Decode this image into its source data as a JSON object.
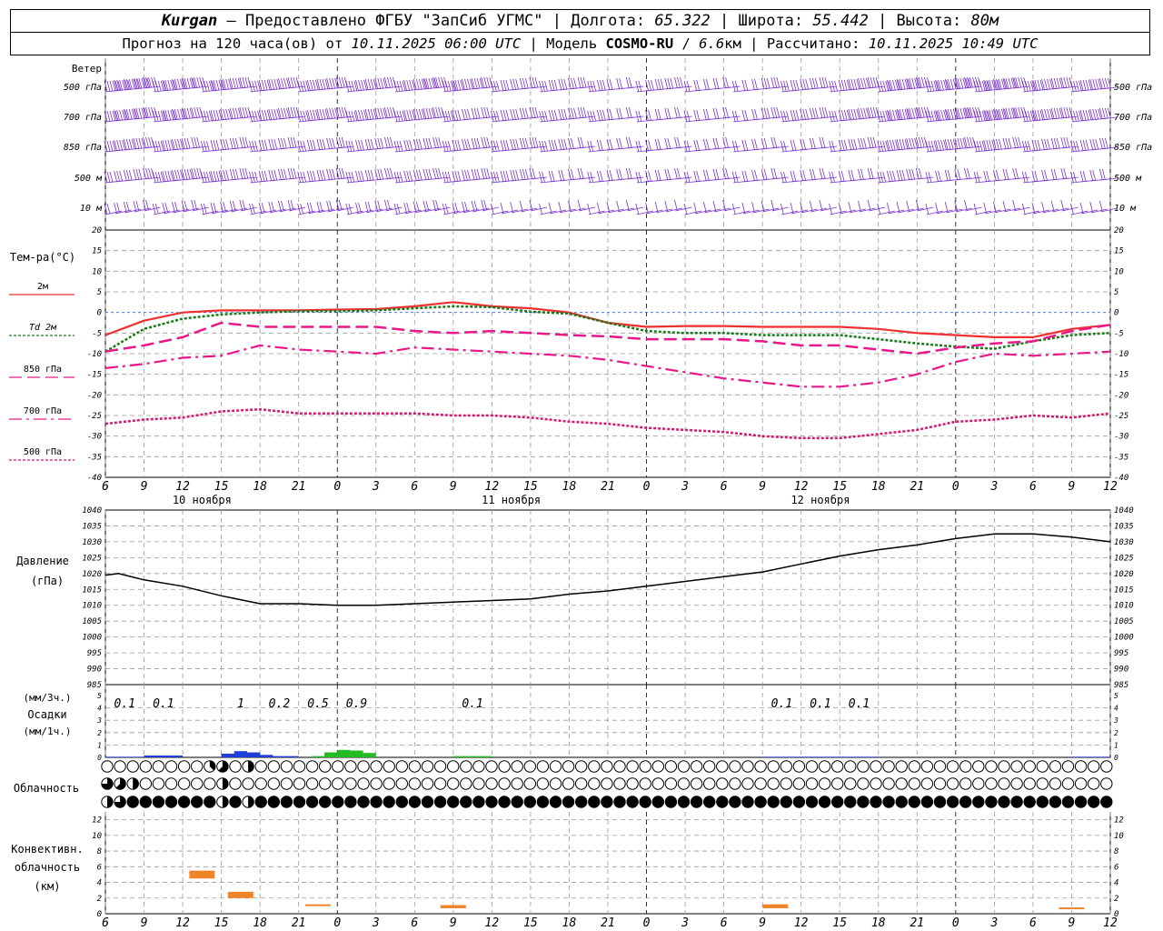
{
  "header": {
    "station": "Kurgan",
    "dash": "—",
    "provider_label": "Предоставлено ФГБУ \"ЗапСиб УГМС\"",
    "lon_label": "Долгота:",
    "lon": "65.322",
    "lat_label": "Широта:",
    "lat": "55.442",
    "alt_label": "Высота:",
    "alt": "80м",
    "forecast_label": "Прогноз на 120 часа(ов) от",
    "forecast_time": "10.11.2025 06:00 UTC",
    "model_label": "Модель",
    "model": "COSMO-RU",
    "model_res": "6.6",
    "model_res_unit": "км",
    "computed_label": "Рассчитано:",
    "computed_time": "10.11.2025 10:49 UTC"
  },
  "colors": {
    "wind": "#7a2fc8",
    "t2m": "#ee3030",
    "td2m": "#1a7a1a",
    "t850": "#e8188a",
    "t700": "#e8188a",
    "t500": "#d4186e",
    "pressure": "#000000",
    "precip3h": "#1f3fd8",
    "precip1h": "#22bb22",
    "convective": "#f08428",
    "grid": "#999999",
    "zero_line": "#3060e0"
  },
  "chart_data": [
    {
      "type": "wind_barbs",
      "title": "Ветер",
      "levels": [
        "500 гПа",
        "700 гПа",
        "850 гПа",
        "500 м",
        "10 м"
      ]
    },
    {
      "type": "line",
      "ylabel": "Тем-ра(°C)",
      "ylim": [
        -40,
        20
      ],
      "yticks": [
        20,
        15,
        10,
        5,
        0,
        -5,
        -10,
        -15,
        -20,
        -25,
        -30,
        -35,
        -40
      ],
      "x_hours": [
        6,
        9,
        12,
        15,
        18,
        21,
        24,
        27,
        30,
        33,
        36,
        39,
        42,
        45,
        48,
        51,
        54,
        57,
        60,
        63,
        66,
        69,
        72,
        75,
        78,
        81,
        84
      ],
      "x_tick_labels": [
        "6",
        "9",
        "12",
        "15",
        "18",
        "21",
        "0",
        "3",
        "6",
        "9",
        "12",
        "15",
        "18",
        "21",
        "0",
        "3",
        "6",
        "9",
        "12",
        "15",
        "18",
        "21",
        "0",
        "3",
        "6",
        "9",
        "12"
      ],
      "day_labels": [
        "10 ноября",
        "11 ноября",
        "12 ноября"
      ],
      "series": [
        {
          "name": "2м",
          "style": "solid",
          "values": [
            -5.5,
            -2,
            0,
            0.5,
            0.5,
            0.5,
            0.7,
            0.8,
            1.5,
            2.5,
            1.5,
            1,
            0,
            -2.5,
            -3.5,
            -3.3,
            -3.3,
            -3.5,
            -3.5,
            -3.5,
            -4,
            -5,
            -5.5,
            -6,
            -6,
            -4,
            -3
          ]
        },
        {
          "name": "Td 2м",
          "style": "dotted",
          "values": [
            -9.5,
            -4,
            -1.5,
            -0.5,
            0,
            0.3,
            0.3,
            0.5,
            1,
            1.5,
            1.3,
            0.2,
            -0.3,
            -2.5,
            -4.5,
            -5,
            -5,
            -5.5,
            -5.5,
            -5.5,
            -6.5,
            -7.5,
            -8.3,
            -8.8,
            -7,
            -5.5,
            -5
          ]
        },
        {
          "name": "850 гПа",
          "style": "dashed",
          "values": [
            -9.5,
            -8,
            -6,
            -2.5,
            -3.5,
            -3.5,
            -3.5,
            -3.5,
            -4.5,
            -5,
            -4.5,
            -5,
            -5.5,
            -5.8,
            -6.5,
            -6.5,
            -6.5,
            -7,
            -8,
            -8,
            -9,
            -10,
            -8.5,
            -7.5,
            -7,
            -4.5,
            -3
          ]
        },
        {
          "name": "700 гПа",
          "style": "dashdot",
          "values": [
            -13.5,
            -12.5,
            -11,
            -10.5,
            -8,
            -9,
            -9.5,
            -10,
            -8.5,
            -9,
            -9.5,
            -10,
            -10.5,
            -11.5,
            -13,
            -14.5,
            -16,
            -17,
            -18,
            -18,
            -17,
            -15,
            -12,
            -10,
            -10.5,
            -10,
            -9.5
          ]
        },
        {
          "name": "500 гПа",
          "style": "dotted",
          "values": [
            -27,
            -26,
            -25.5,
            -24,
            -23.5,
            -24.5,
            -24.5,
            -24.5,
            -24.5,
            -25,
            -25,
            -25.5,
            -26.5,
            -27,
            -28,
            -28.5,
            -29,
            -30,
            -30.5,
            -30.5,
            -29.5,
            -28.5,
            -26.5,
            -26,
            -25,
            -25.5,
            -24.5
          ]
        }
      ]
    },
    {
      "type": "line",
      "title": "Давление",
      "ylabel": "(гПа)",
      "ylim": [
        985,
        1040
      ],
      "yticks": [
        1040,
        1035,
        1030,
        1025,
        1020,
        1015,
        1010,
        1005,
        1000,
        995,
        990,
        985
      ],
      "x_hours": [
        6,
        7,
        9,
        12,
        15,
        18,
        21,
        24,
        27,
        30,
        33,
        36,
        39,
        42,
        45,
        48,
        51,
        54,
        57,
        60,
        63,
        66,
        69,
        72,
        75,
        78,
        81,
        84
      ],
      "series": [
        {
          "name": "Давление",
          "values": [
            1019.5,
            1020,
            1018,
            1016,
            1013,
            1010.5,
            1010.5,
            1010,
            1010,
            1010.5,
            1011,
            1011.5,
            1012,
            1013.5,
            1014.5,
            1016,
            1017.5,
            1019,
            1020.5,
            1023,
            1025.5,
            1027.5,
            1029,
            1031,
            1032.5,
            1032.5,
            1031.5,
            1030
          ]
        }
      ]
    },
    {
      "type": "bar",
      "ylabel": "(мм/3ч.)",
      "title": "Осадки",
      "y2label": "(мм/1ч.)",
      "ylim": [
        0,
        5
      ],
      "yticks": [
        5,
        4,
        3,
        2,
        1,
        0
      ],
      "amount_labels": [
        {
          "hour": 7.5,
          "text": "0.1"
        },
        {
          "hour": 10.5,
          "text": "0.1"
        },
        {
          "hour": 16.5,
          "text": "1"
        },
        {
          "hour": 19.5,
          "text": "0.2"
        },
        {
          "hour": 22.5,
          "text": "0.5"
        },
        {
          "hour": 25.5,
          "text": "0.9"
        },
        {
          "hour": 34.5,
          "text": "0.1"
        },
        {
          "hour": 58.5,
          "text": "0.1"
        },
        {
          "hour": 61.5,
          "text": "0.1"
        },
        {
          "hour": 64.5,
          "text": "0.1"
        }
      ],
      "series": [
        {
          "name": "мм/3ч",
          "hours": [
            6,
            9,
            15,
            18,
            33,
            57,
            60,
            63,
            81
          ],
          "values": [
            0.05,
            0.15,
            0.3,
            0.1,
            0.05,
            0.05,
            0.05,
            0.05,
            0.05
          ]
        },
        {
          "name": "мм/1ч",
          "hours": [
            15,
            16,
            17,
            18,
            22,
            23,
            24,
            25,
            26,
            33,
            34,
            35
          ],
          "values": [
            0.25,
            0.5,
            0.4,
            0.2,
            0.1,
            0.4,
            0.6,
            0.55,
            0.35,
            0.1,
            0.1,
            0.1
          ]
        }
      ]
    },
    {
      "type": "cloud_cover",
      "title": "Облачность",
      "rows": [
        "upper",
        "middle",
        "lower"
      ],
      "cover_eighths": {
        "upper": [
          0,
          0,
          0,
          0,
          0,
          0,
          0,
          0,
          3,
          5,
          0,
          4,
          0,
          0,
          0,
          0,
          0,
          0,
          0,
          0,
          0,
          0,
          0,
          0,
          0,
          0,
          0,
          0,
          0,
          0,
          0,
          0,
          0,
          0,
          0,
          0,
          0,
          0,
          0,
          0,
          0,
          0,
          0,
          0,
          0,
          0,
          0,
          0,
          0,
          0,
          0,
          0,
          0,
          0,
          0,
          0,
          0,
          0,
          0,
          0,
          0,
          0,
          0,
          0,
          0,
          0,
          0,
          0,
          0,
          0,
          0,
          0,
          0,
          0,
          0,
          0,
          0,
          0,
          0
        ],
        "middle": [
          6,
          5,
          4,
          0,
          0,
          0,
          0,
          0,
          0,
          4,
          0,
          0,
          0,
          0,
          0,
          0,
          0,
          0,
          0,
          0,
          0,
          0,
          0,
          0,
          0,
          0,
          0,
          0,
          0,
          0,
          0,
          0,
          0,
          0,
          0,
          0,
          0,
          0,
          0,
          0,
          0,
          0,
          0,
          0,
          0,
          0,
          0,
          0,
          0,
          0,
          0,
          0,
          0,
          0,
          0,
          0,
          0,
          0,
          0,
          0,
          0,
          0,
          0,
          0,
          0,
          0,
          0,
          0,
          0,
          0,
          0,
          0,
          0,
          0,
          0,
          0,
          0,
          0,
          0
        ],
        "lower": [
          4,
          6,
          8,
          8,
          8,
          8,
          8,
          8,
          8,
          4,
          8,
          4,
          8,
          8,
          8,
          8,
          8,
          8,
          8,
          8,
          8,
          8,
          8,
          8,
          8,
          8,
          8,
          8,
          8,
          8,
          8,
          8,
          8,
          8,
          8,
          8,
          8,
          8,
          8,
          8,
          8,
          8,
          8,
          8,
          8,
          8,
          8,
          8,
          8,
          8,
          8,
          8,
          8,
          8,
          8,
          8,
          8,
          8,
          8,
          8,
          8,
          8,
          8,
          8,
          8,
          8,
          8,
          8,
          8,
          8,
          8,
          8,
          8,
          8,
          8,
          8,
          8,
          8,
          8
        ]
      }
    },
    {
      "type": "bar",
      "title": "Конвективн. облачность",
      "ylabel": "(км)",
      "ylim": [
        0,
        13
      ],
      "yticks": [
        12,
        10,
        8,
        6,
        4,
        2,
        0
      ],
      "series": [
        {
          "name": "Конвективная облачность",
          "bars": [
            {
              "hour": 13.5,
              "bottom": 4.5,
              "top": 5.5
            },
            {
              "hour": 16.5,
              "bottom": 2,
              "top": 2.8
            },
            {
              "hour": 22.5,
              "bottom": 1,
              "top": 1.2
            },
            {
              "hour": 33,
              "bottom": 0.7,
              "top": 1.1
            },
            {
              "hour": 58,
              "bottom": 0.7,
              "top": 1.2
            },
            {
              "hour": 81,
              "bottom": 0.7,
              "top": 0.8
            }
          ]
        }
      ]
    }
  ]
}
